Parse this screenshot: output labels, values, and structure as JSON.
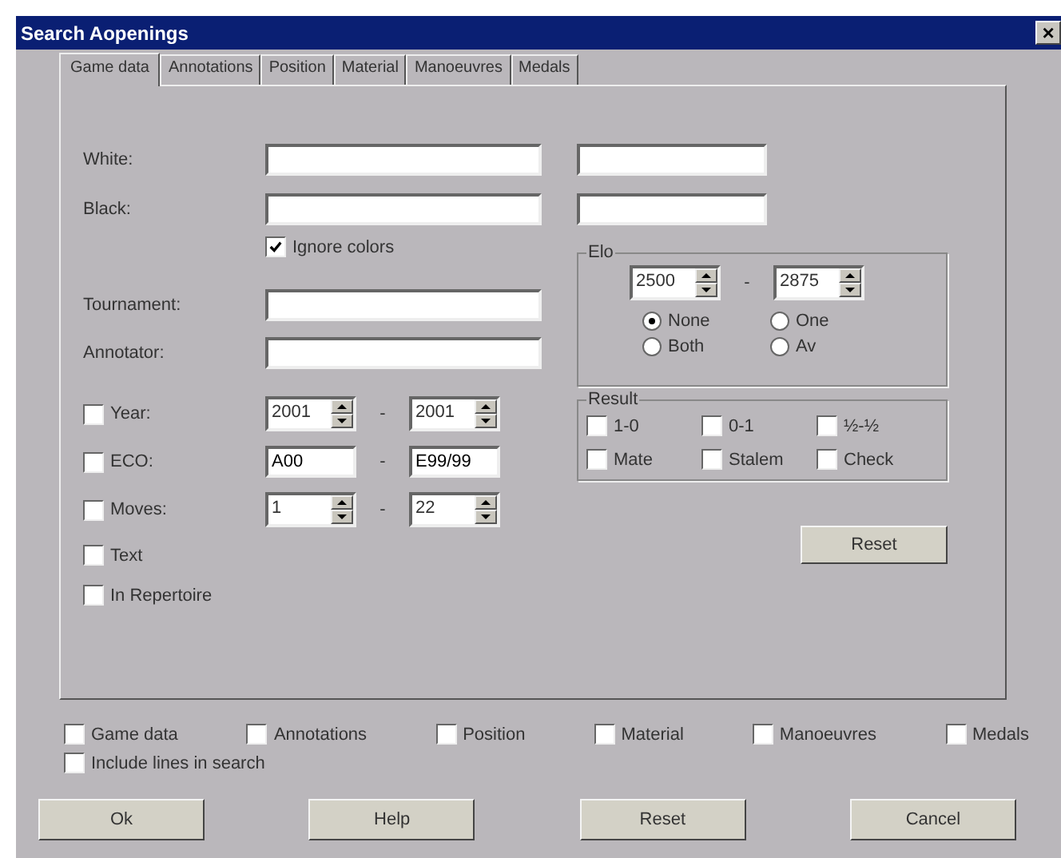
{
  "window": {
    "title": "Search Aopenings",
    "close": "×"
  },
  "tabs": [
    {
      "label": "Game data",
      "selected": true
    },
    {
      "label": "Annotations",
      "selected": false
    },
    {
      "label": "Position",
      "selected": false
    },
    {
      "label": "Material",
      "selected": false
    },
    {
      "label": "Manoeuvres",
      "selected": false
    },
    {
      "label": "Medals",
      "selected": false
    }
  ],
  "players": [
    {
      "label": "White:"
    },
    {
      "label": "Black:"
    }
  ],
  "ignore_colors": {
    "label": "Ignore colors",
    "checked": true
  },
  "text_fields": [
    {
      "label": "Tournament:"
    },
    {
      "label": "Annotator:"
    }
  ],
  "ranges": [
    {
      "label": "Year:",
      "checked": false,
      "kind": "spin",
      "from": "2001",
      "to": "2001",
      "separator": "-"
    },
    {
      "label": "ECO:",
      "checked": false,
      "kind": "text",
      "from": "A00",
      "to": "E99/99",
      "separator": "-"
    },
    {
      "label": "Moves:",
      "checked": false,
      "kind": "spin",
      "from": "1",
      "to": "22",
      "separator": "-"
    }
  ],
  "options": [
    {
      "label": "Text",
      "checked": false
    },
    {
      "label": "In Repertoire",
      "checked": false
    }
  ],
  "elo": {
    "title": "Elo",
    "from": "2500",
    "to": "2875",
    "separator": "-",
    "modes": [
      {
        "label": "None",
        "selected": true
      },
      {
        "label": "One",
        "selected": false
      },
      {
        "label": "Both",
        "selected": false
      },
      {
        "label": "Av",
        "selected": false
      }
    ]
  },
  "result": {
    "title": "Result",
    "items": [
      {
        "label": "1-0",
        "checked": false
      },
      {
        "label": "0-1",
        "checked": false
      },
      {
        "label": "½-½",
        "checked": false
      },
      {
        "label": "Mate",
        "checked": false
      },
      {
        "label": "Stalem",
        "checked": false
      },
      {
        "label": "Check",
        "checked": false
      }
    ]
  },
  "panel_button": "Reset",
  "sections": [
    {
      "label": "Game data",
      "checked": false
    },
    {
      "label": "Annotations",
      "checked": false
    },
    {
      "label": "Position",
      "checked": false
    },
    {
      "label": "Material",
      "checked": false
    },
    {
      "label": "Manoeuvres",
      "checked": false
    },
    {
      "label": "Medals",
      "checked": false
    }
  ],
  "include_lines": {
    "label": "Include lines in search",
    "checked": false
  },
  "buttons": [
    "Ok",
    "Help",
    "Reset",
    "Cancel"
  ]
}
